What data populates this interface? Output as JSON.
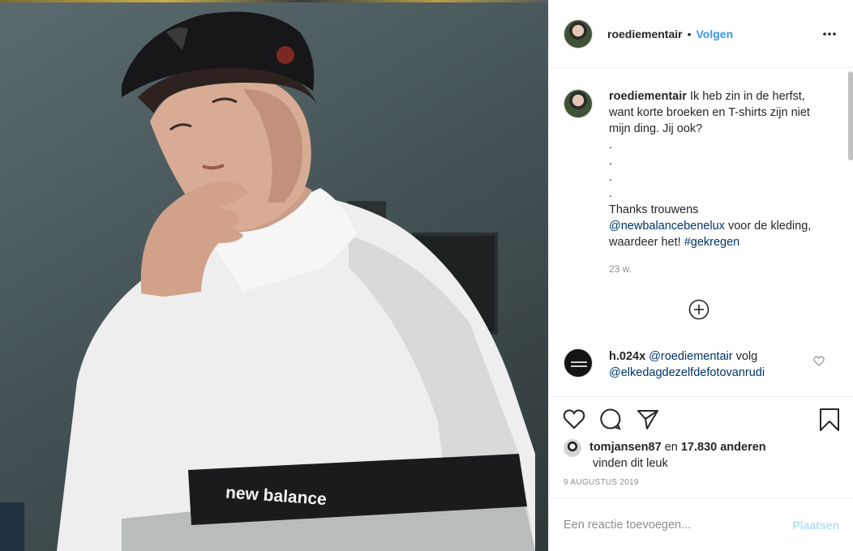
{
  "header": {
    "username": "roediementair",
    "separator": "•",
    "follow_label": "Volgen",
    "more_icon": "more-horizontal-icon"
  },
  "caption": {
    "username": "roediementair",
    "text_1": "Ik heb zin in de herfst, want korte broeken en T-shirts zijn niet mijn ding. Jij ook?",
    "dots": [
      ".",
      ".",
      ".",
      "."
    ],
    "text_2": "Thanks trouwens",
    "mention": "@newbalancebenelux",
    "text_3": "voor de kleding, waardeer het!",
    "hashtag": "#gekregen",
    "time": "23 w."
  },
  "load_more_icon": "plus-circle-icon",
  "reply": {
    "username": "h.024x",
    "mention_1": "@roediementair",
    "text": "volg",
    "mention_2": "@elkedagdezelfdefotovanrudi",
    "like_icon": "heart-icon"
  },
  "actions": {
    "like_icon": "heart-icon",
    "comment_icon": "comment-icon",
    "share_icon": "paper-plane-icon",
    "save_icon": "bookmark-icon"
  },
  "likes": {
    "liker": "tomjansen87",
    "connector": "en",
    "count": "17.830 anderen",
    "suffix": "vinden dit leuk"
  },
  "date": "9 AUGUSTUS 2019",
  "comment_box": {
    "placeholder": "Een reactie toevoegen...",
    "post_label": "Plaatsen"
  },
  "photo": {
    "jacket_logo_text": "new balance"
  },
  "colors": {
    "link": "#3897f0",
    "tag": "#003569",
    "muted": "#8e8e8e",
    "post_disabled": "#b2dffc"
  }
}
